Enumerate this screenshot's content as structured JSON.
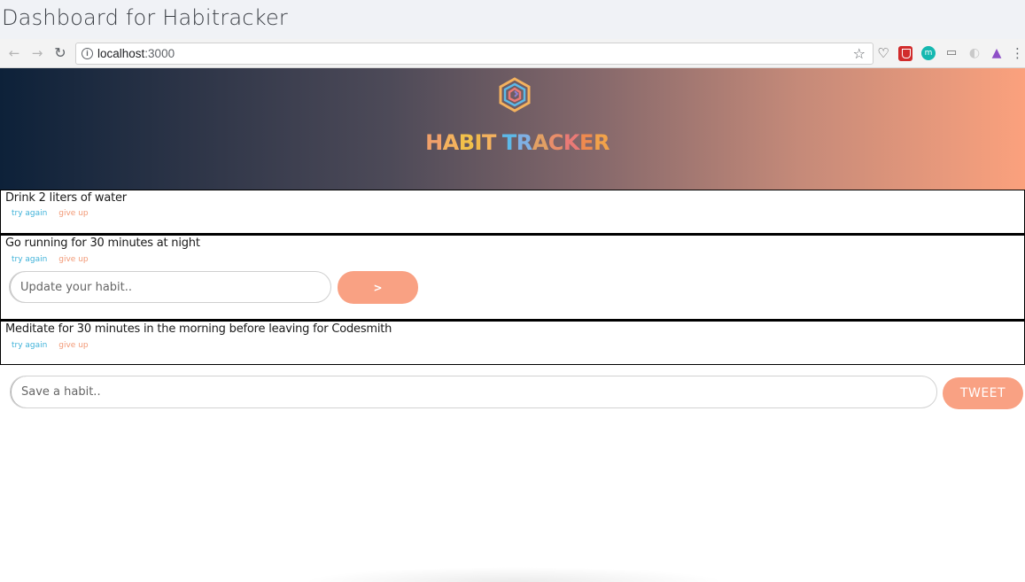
{
  "page": {
    "title": "Dashboard for Habitracker"
  },
  "browser": {
    "url_host": "localhost",
    "url_port": ":3000",
    "icons": [
      "back-arrow-icon",
      "forward-arrow-icon",
      "reload-icon",
      "info-icon",
      "bookmark-star-icon",
      "heart-extension-icon",
      "shield-extension-icon",
      "m-extension-icon",
      "cast-icon",
      "grey-extension-icon",
      "triangle-extension-icon",
      "menu-kebab-icon"
    ],
    "extension_m_label": "m"
  },
  "banner": {
    "brand_letters": [
      "H",
      "A",
      "B",
      "I",
      "T",
      " ",
      "T",
      "R",
      "A",
      "C",
      "K",
      "E",
      "R"
    ],
    "brand_text": "HABIT TRACKER",
    "gradient": [
      "#0d2139",
      "#fba17d"
    ]
  },
  "habits": [
    {
      "text": "Drink 2 liters of water",
      "try_again": "try again",
      "give_up": "give up"
    },
    {
      "text": "Go running for 30 minutes at night",
      "try_again": "try again",
      "give_up": "give up",
      "update_placeholder": "Update your habit..",
      "update_button": ">"
    },
    {
      "text": "Meditate for 30 minutes in the morning before leaving for Codesmith",
      "try_again": "try again",
      "give_up": "give up"
    }
  ],
  "composer": {
    "placeholder": "Save a habit..",
    "submit_label": "TWEET"
  },
  "colors": {
    "accent": "#f9a183",
    "link_try": "#3fb2d9",
    "link_give_up": "#f29a77"
  }
}
